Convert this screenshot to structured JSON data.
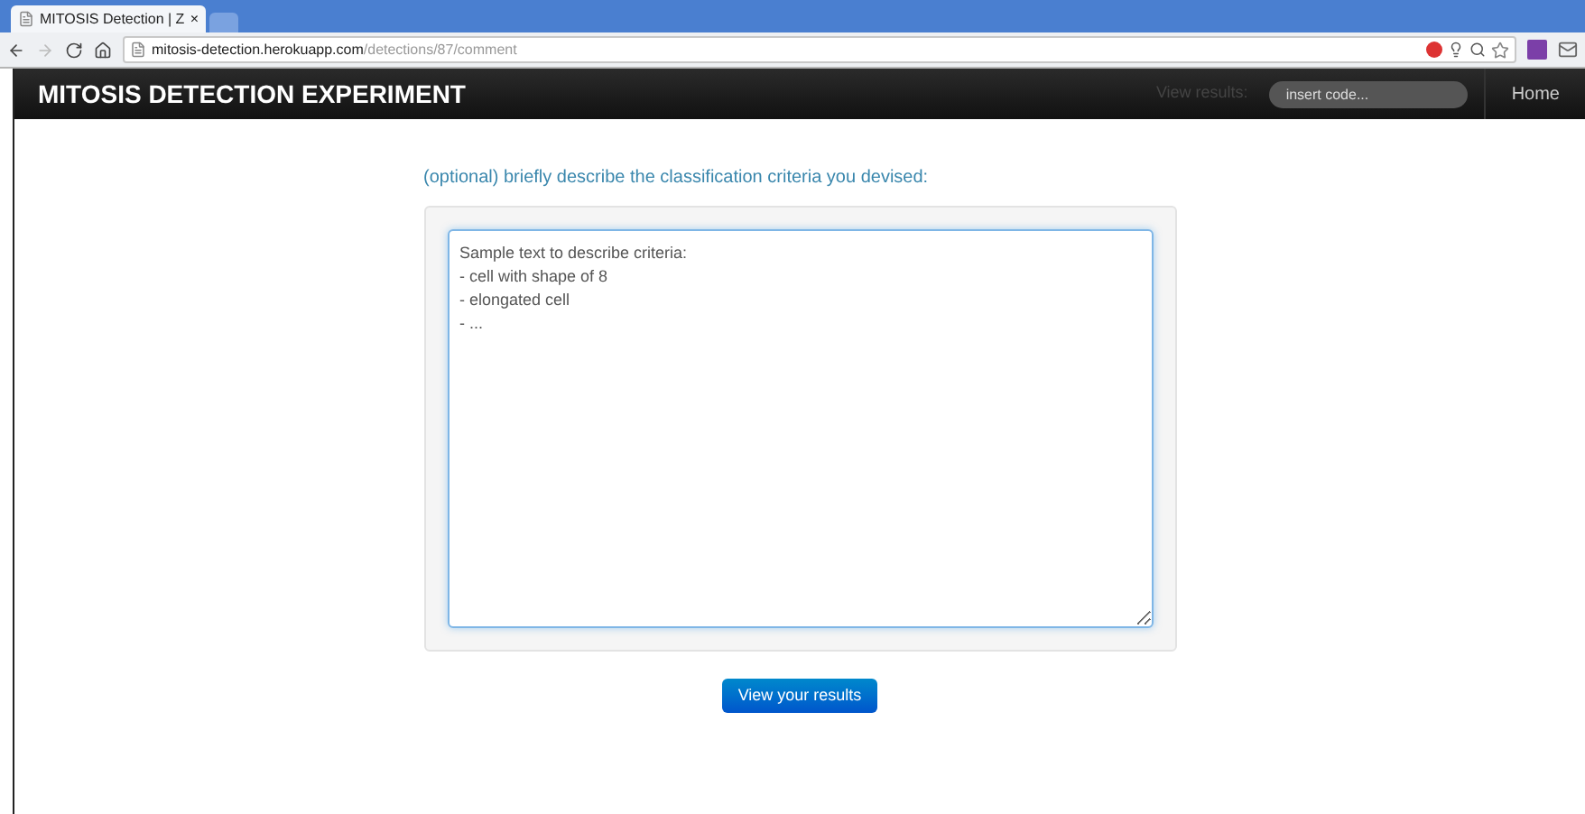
{
  "browser": {
    "tab_title": "MITOSIS Detection | Z",
    "tab_close": "×",
    "url_host": "mitosis-detection.herokuapp.com",
    "url_path": "/detections/87/comment"
  },
  "navbar": {
    "brand": "MITOSIS DETECTION EXPERIMENT",
    "view_results_label": "View results:",
    "code_field": {
      "placeholder": "insert code..."
    },
    "home_link": "Home"
  },
  "form": {
    "prompt": "(optional) briefly describe the classification criteria you devised:",
    "criteria_field": {
      "placeholder": "Sample text to describe criteria:\n- cell with shape of 8\n- elongated cell\n- ..."
    },
    "submit_button": "View your results"
  }
}
